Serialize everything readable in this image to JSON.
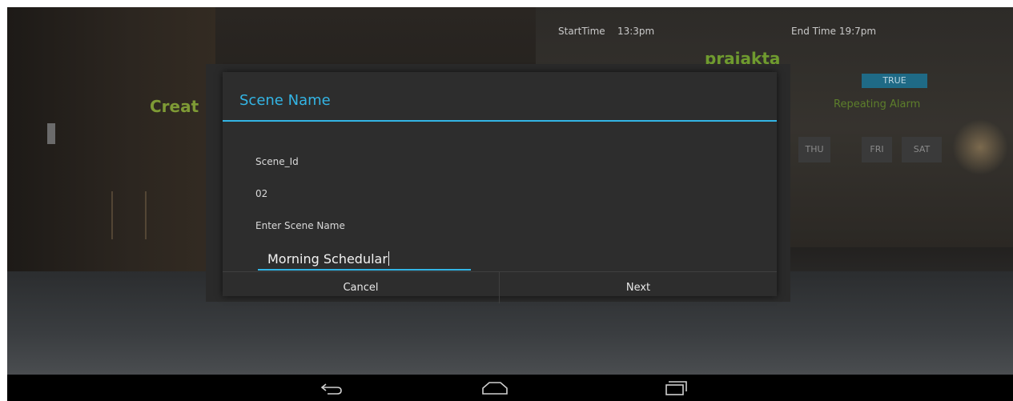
{
  "background": {
    "start_time_label": "StartTime",
    "start_time_value": "13:3pm",
    "end_time_label": "End Time",
    "end_time_value": "19:7pm",
    "username": "prajakta",
    "true_badge": "TRUE",
    "create_label": "Creat",
    "repeating_alarm_label": "Repeating Alarm",
    "days": [
      "THU",
      "FRI",
      "SAT"
    ]
  },
  "dialog": {
    "title": "Scene Name",
    "scene_id_label": "Scene_Id",
    "scene_id_value": "02",
    "enter_name_label": "Enter Scene Name",
    "scene_name_value": "Morning Schedular",
    "cancel_label": "Cancel",
    "next_label": "Next"
  },
  "navbar": {
    "icons": [
      "back-icon",
      "home-icon",
      "recent-apps-icon"
    ]
  },
  "colors": {
    "accent": "#33b5e5",
    "username": "#6f9b2f",
    "dialog_bg": "#2d2d2d"
  }
}
